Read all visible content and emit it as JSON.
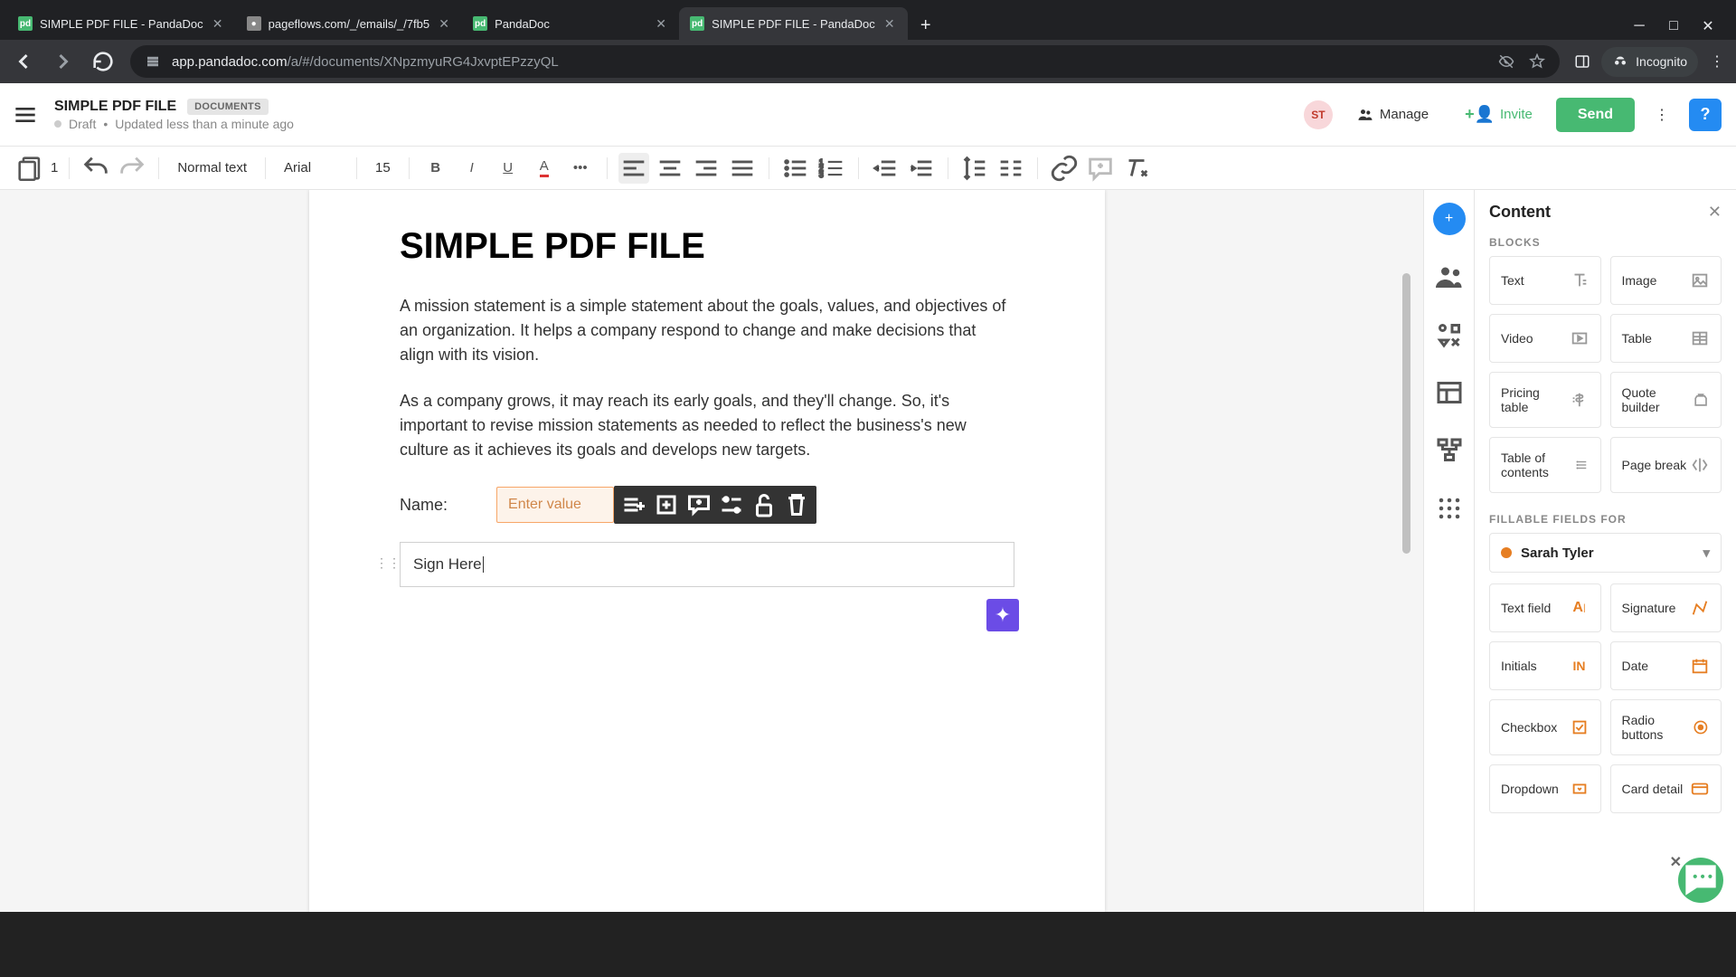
{
  "browser": {
    "tabs": [
      {
        "title": "SIMPLE PDF FILE - PandaDoc",
        "active": false
      },
      {
        "title": "pageflows.com/_/emails/_/7fb5",
        "active": false
      },
      {
        "title": "PandaDoc",
        "active": false
      },
      {
        "title": "SIMPLE PDF FILE - PandaDoc",
        "active": true
      }
    ],
    "url_domain": "app.pandadoc.com",
    "url_path": "/a/#/documents/XNpzmyuRG4JxvptEPzzyQL",
    "incognito": "Incognito"
  },
  "header": {
    "title": "SIMPLE PDF FILE",
    "badge": "DOCUMENTS",
    "status_state": "Draft",
    "status_time": "Updated less than a minute ago",
    "avatar": "ST",
    "manage": "Manage",
    "invite": "Invite",
    "send": "Send"
  },
  "toolbar": {
    "page_num": "1",
    "style": "Normal text",
    "font": "Arial",
    "size": "15"
  },
  "doc": {
    "heading": "SIMPLE PDF FILE",
    "para1": "A mission statement is a simple statement about the goals, values, and objectives of an organization. It helps a company respond to change and make decisions that align with its vision.",
    "para2": "As a company grows, it may reach its early goals, and they'll change. So, it's important to revise mission statements as needed to reflect the business's new culture as it achieves its goals and develops new targets.",
    "name_label": "Name:",
    "name_placeholder": "Enter value",
    "sign_text": "Sign Here "
  },
  "panel": {
    "title": "Content",
    "blocks_label": "BLOCKS",
    "blocks": {
      "text": "Text",
      "image": "Image",
      "video": "Video",
      "table": "Table",
      "pricing": "Pricing table",
      "quote": "Quote builder",
      "toc": "Table of contents",
      "pagebreak": "Page break"
    },
    "fields_label": "FILLABLE FIELDS FOR",
    "person": "Sarah Tyler",
    "fields": {
      "textfield": "Text field",
      "signature": "Signature",
      "initials": "Initials",
      "date": "Date",
      "checkbox": "Checkbox",
      "radio": "Radio buttons",
      "dropdown": "Dropdown",
      "card": "Card detail"
    }
  }
}
